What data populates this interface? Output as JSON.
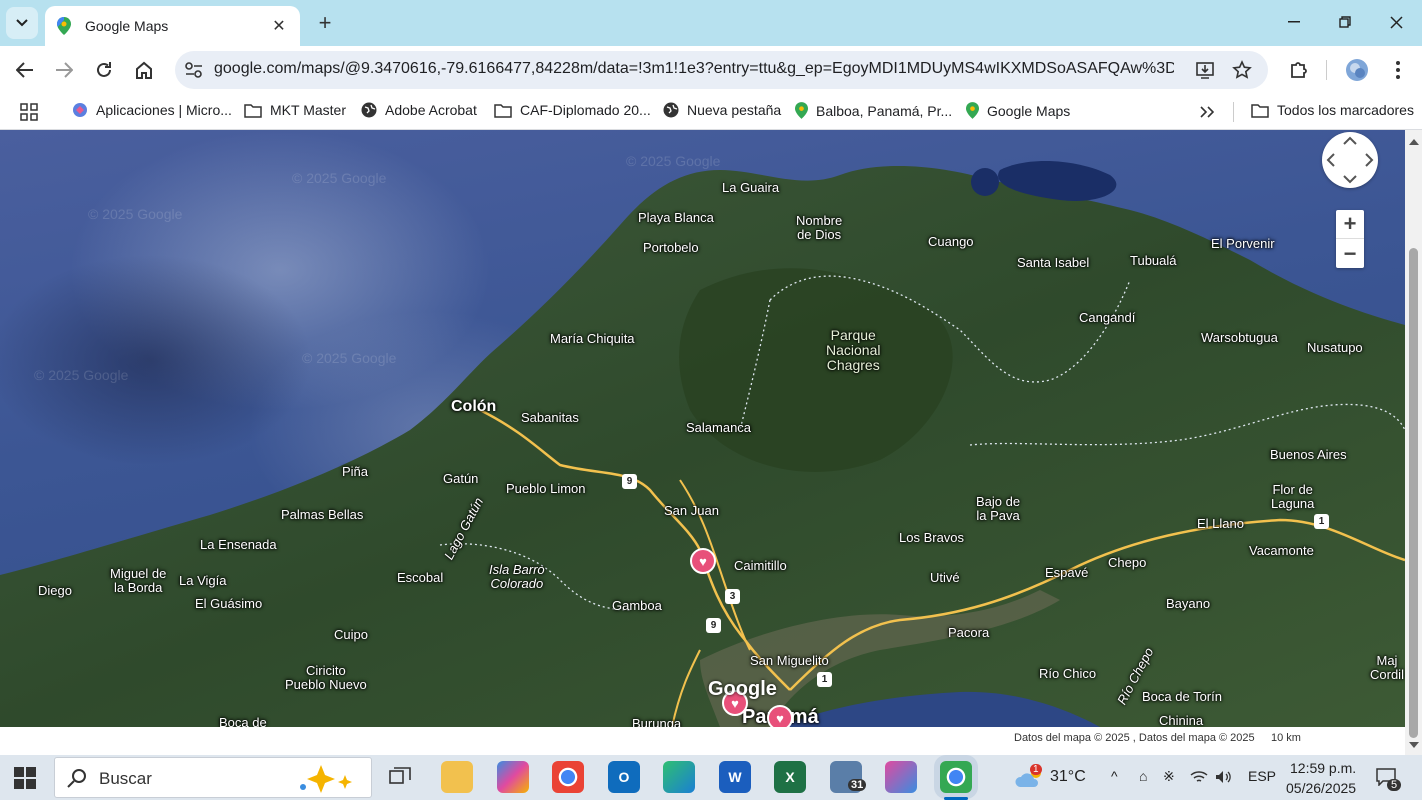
{
  "browser": {
    "tab_title": "Google Maps",
    "url": "google.com/maps/@9.3470616,-79.6166477,84228m/data=!3m1!1e3?entry=ttu&g_ep=EgoyMDI1MDUyMS4wIKXMDSoASAFQAw%3D%3D"
  },
  "bookmarks": [
    {
      "label": "Aplicaciones | Micro...",
      "icon": "microsoft-icon"
    },
    {
      "label": "MKT Master",
      "icon": "folder-icon"
    },
    {
      "label": "Adobe Acrobat",
      "icon": "globe-icon"
    },
    {
      "label": "CAF-Diplomado 20...",
      "icon": "folder-icon"
    },
    {
      "label": "Nueva pestaña",
      "icon": "globe-icon"
    },
    {
      "label": "Balboa, Panamá, Pr...",
      "icon": "maps-pin-icon"
    },
    {
      "label": "Google Maps",
      "icon": "maps-pin-icon"
    }
  ],
  "all_bookmarks_label": "Todos los marcadores",
  "map": {
    "places": [
      {
        "name": "La Guaira"
      },
      {
        "name": "Playa Blanca"
      },
      {
        "name": "Portobelo"
      },
      {
        "name": "Nombre\nde Dios"
      },
      {
        "name": "Cuango"
      },
      {
        "name": "Santa Isabel"
      },
      {
        "name": "Tubualá"
      },
      {
        "name": "El Porvenir"
      },
      {
        "name": "Cangandí"
      },
      {
        "name": "Warsobtugua"
      },
      {
        "name": "Nusatupo"
      },
      {
        "name": "María Chiquita"
      },
      {
        "name": "Colón"
      },
      {
        "name": "Sabanitas"
      },
      {
        "name": "Salamanca"
      },
      {
        "name": "Buenos Aires"
      },
      {
        "name": "Piña"
      },
      {
        "name": "Gatún"
      },
      {
        "name": "Pueblo Limon"
      },
      {
        "name": "San Juan"
      },
      {
        "name": "Bajo de\nla Pava"
      },
      {
        "name": "Flor de\nLaguna"
      },
      {
        "name": "Palmas Bellas"
      },
      {
        "name": "El Llano"
      },
      {
        "name": "La Ensenada"
      },
      {
        "name": "Los Bravos"
      },
      {
        "name": "Caimitillo"
      },
      {
        "name": "Vacamonte"
      },
      {
        "name": "Chepo"
      },
      {
        "name": "Espavé"
      },
      {
        "name": "Utivé"
      },
      {
        "name": "Diego"
      },
      {
        "name": "Miguel de\nla Borda"
      },
      {
        "name": "La Vigía"
      },
      {
        "name": "Escobal"
      },
      {
        "name": "Isla Barro\nColorado"
      },
      {
        "name": "El Guásimo"
      },
      {
        "name": "Gamboa"
      },
      {
        "name": "Bayano"
      },
      {
        "name": "Pacora"
      },
      {
        "name": "Cuipo"
      },
      {
        "name": "San Miguelito"
      },
      {
        "name": "Río Chico"
      },
      {
        "name": "Ciricito\nPueblo Nuevo"
      },
      {
        "name": "Boca de Torín"
      },
      {
        "name": "Chinina"
      },
      {
        "name": "Boca de"
      },
      {
        "name": "Burunga"
      },
      {
        "name": "Panamá"
      },
      {
        "name": "Maj\nCordil"
      }
    ],
    "park_label": "Parque\nNacional\nChagres",
    "water_labels": [
      "Lago Gatún",
      "Río Chepo"
    ],
    "road_shields": [
      "9",
      "3",
      "9",
      "1",
      "1"
    ],
    "watermark": "© 2025 Google",
    "logo": "Google",
    "attribution": "Datos del mapa © 2025 , Datos del mapa © 2025",
    "scale": "10 km"
  },
  "taskbar": {
    "search_placeholder": "Buscar",
    "mail_badge": "31",
    "weather_badge": "1",
    "temperature": "31°C",
    "language": "ESP",
    "time": "12:59 p.m.",
    "date": "05/26/2025",
    "notifications": "5"
  }
}
